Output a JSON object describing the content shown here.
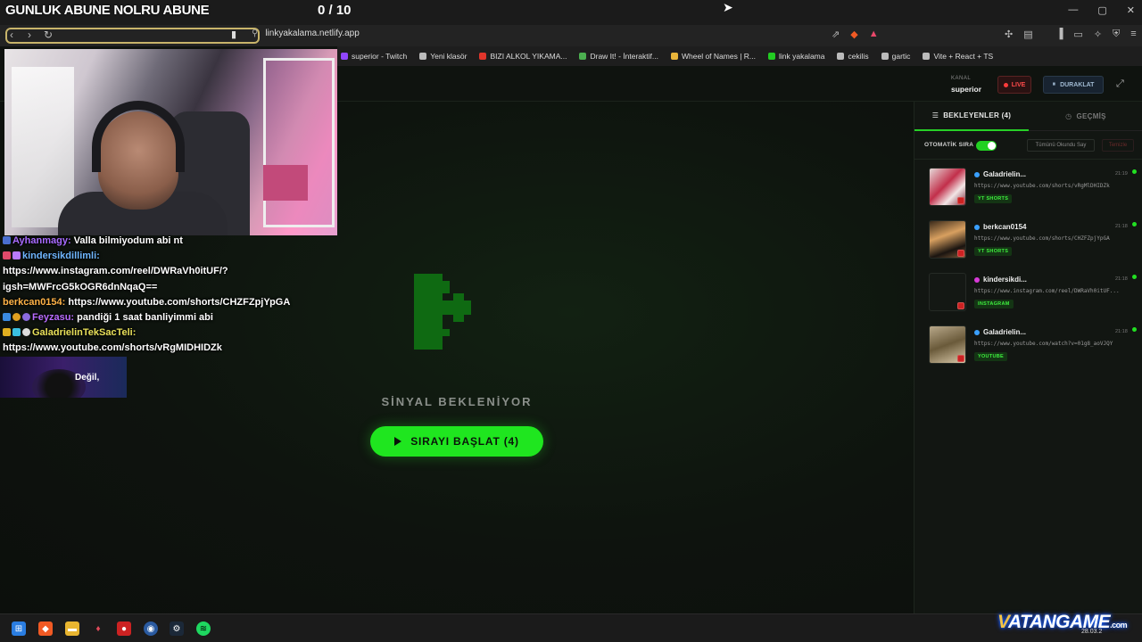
{
  "overlay": {
    "title": "GUNLUK ABUNE NOLRU ABUNE",
    "count": "0 / 10"
  },
  "browser": {
    "url": "linkyakalama.netlify.app",
    "bookmarks": [
      {
        "label": "superior - Twitch",
        "color": "#9146ff"
      },
      {
        "label": "Yeni klasör",
        "color": "#bbbbbb"
      },
      {
        "label": "BIZI ALKOL YIKAMA...",
        "color": "#e0352b"
      },
      {
        "label": "Draw It! - İnteraktif...",
        "color": "#4caf50"
      },
      {
        "label": "Wheel of Names | R...",
        "color": "#e9b53a"
      },
      {
        "label": "link yakalama",
        "color": "#22cc22"
      },
      {
        "label": "cekilis",
        "color": "#bbbbbb"
      },
      {
        "label": "gartic",
        "color": "#bbbbbb"
      },
      {
        "label": "Vite + React + TS",
        "color": "#bbbbbb"
      }
    ]
  },
  "header": {
    "kanal_label": "KANAL",
    "kanal_name": "superior",
    "live_label": "LIVE",
    "pause_label": "DURAKLAT"
  },
  "chat": {
    "lines": [
      {
        "user": "Ayhanmagy:",
        "text": " Valla bilmiyodum abi nt"
      },
      {
        "user": "kindersikdillimli:",
        "text": ""
      },
      {
        "user": "",
        "text": "https://www.instagram.com/reel/DWRaVh0itUF/?"
      },
      {
        "user": "",
        "text": "igsh=MWFrcG5kOGR6dnNqaQ=="
      },
      {
        "user": "berkcan0154:",
        "text": " https://www.youtube.com/shorts/CHZFZpjYpGA"
      },
      {
        "user": "Feyzasu:",
        "text": " pandiği 1 saat banliyimmi abi"
      },
      {
        "user": "GaladrielinTekSacTeli:",
        "text": ""
      },
      {
        "user": "",
        "text": "https://www.youtube.com/shorts/vRgMIDHIDZk"
      }
    ],
    "clip_text": "Değil,"
  },
  "center": {
    "status": "SİNYAL BEKLENİYOR",
    "start_button": "SIRAYI BAŞLAT (4)"
  },
  "panel": {
    "tab_waiting": "BEKLEYENLER (4)",
    "tab_history": "GEÇMİŞ",
    "auto_queue_label": "OTOMATİK SIRA",
    "auto_queue_on": true,
    "mark_read_label": "Tümünü Okundu Say",
    "clear_label": "Temizle",
    "items": [
      {
        "user": "Galadrielin...",
        "time": "21:19",
        "url": "https://www.youtube.com/shorts/vRgMlDHIDZk",
        "tag": "YT SHORTS",
        "thumb": "linear-gradient(135deg,#e5d8d8,#c22f4a 45%,#f2e6e6 70%,#7a2a3a)"
      },
      {
        "user": "berkcan0154",
        "time": "21:18",
        "url": "https://www.youtube.com/shorts/CHZFZpjYpGA",
        "tag": "YT SHORTS",
        "thumb": "linear-gradient(160deg,#3a2a1a,#d8a060 40%,#1a1410 75%,#7a5a3a)"
      },
      {
        "user": "kindersikdi...",
        "time": "21:18",
        "url": "https://www.instagram.com/reel/DWRaVh0itUF...",
        "tag": "INSTAGRAM",
        "thumb": "linear-gradient(135deg,#141814,#141814)"
      },
      {
        "user": "Galadrielin...",
        "time": "21:18",
        "url": "https://www.youtube.com/watch?v=01g8_aoVJQY",
        "tag": "YOUTUBE",
        "thumb": "linear-gradient(160deg,#b8a88a,#6a5a3a 50%,#d8c8a8)"
      }
    ]
  },
  "taskbar": {
    "date": "28.03.2"
  },
  "watermark": {
    "brand_v": "V",
    "brand_rest": "ATANGAME",
    "suffix": ".com"
  }
}
